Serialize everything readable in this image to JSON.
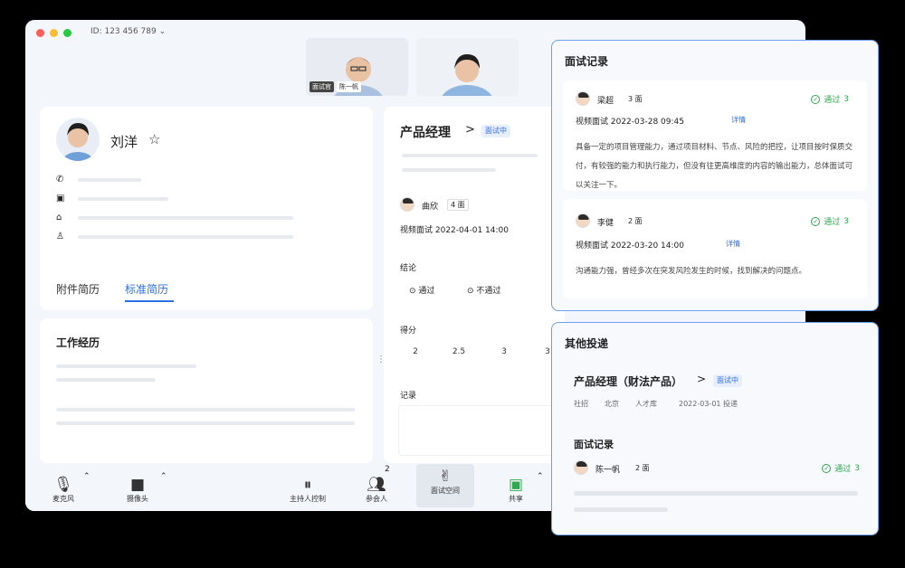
{
  "window": {
    "meeting_id": "ID: 123 456 789",
    "dropdown_caret": "⌄",
    "traffic_colors": [
      "#ff5f57",
      "#febc2e",
      "#28c840"
    ]
  },
  "video_tiles": [
    {
      "name_tag": "面试官",
      "sub_tag": "陈一帆"
    },
    {
      "name_tag": "",
      "sub_tag": ""
    }
  ],
  "candidate": {
    "name": "刘洋",
    "star": "☆",
    "tabs": [
      "附件简历",
      "标准简历"
    ],
    "active_tab": 1
  },
  "work": {
    "title": "工作经历"
  },
  "center": {
    "title": "产品经理",
    "arrow": ">",
    "badge": "面试中",
    "interviewer": "曲欣",
    "round": "4 面",
    "session": "视频面试 2022-04-01 14:00",
    "conclusion_label": "结论",
    "pass_label": "通过",
    "fail_label": "不通过",
    "score_label": "得分",
    "scores": [
      "2",
      "2.5",
      "3",
      "3"
    ],
    "record_label": "记录"
  },
  "interview_records": {
    "title": "面试记录",
    "records": [
      {
        "name": "梁超",
        "round": "3 面",
        "session": "视频面试 2022-03-28 09:45",
        "details": "详情",
        "status": "通过",
        "round_num": "3",
        "comment": "具备一定的项目管理能力，通过项目材料、节点、风险的把控，让项目按时保质交付，有较强的能力和执行能力，但没有往更高维度的内容的输出能力，总体面试可以关注一下。"
      },
      {
        "name": "李健",
        "round": "2 面",
        "session": "视频面试 2022-03-20 14:00",
        "details": "详情",
        "status": "通过",
        "round_num": "3",
        "comment": "沟通能力强，曾经多次在突发风险发生的时候，找到解决的问题点。"
      }
    ]
  },
  "other_deliveries": {
    "title": "其他投递",
    "job": "产品经理（财法产品）",
    "arrow": ">",
    "badge": "面试中",
    "meta": [
      "社招",
      "北京",
      "人才库",
      "2022-03-01 投递"
    ],
    "sub_title": "面试记录",
    "record": {
      "name": "陈一帆",
      "round": "2 面",
      "status": "通过",
      "round_num": "3"
    }
  },
  "toolbar": {
    "mic": "麦克风",
    "camera": "摄像头",
    "host": "主持人控制",
    "participants": "参会人",
    "participant_count": "2",
    "interview_space": "面试空间",
    "share": "共享"
  },
  "colors": {
    "accent": "#2f6fe4",
    "pass": "#2fa84f",
    "panel_border": "#6aa0ee"
  }
}
